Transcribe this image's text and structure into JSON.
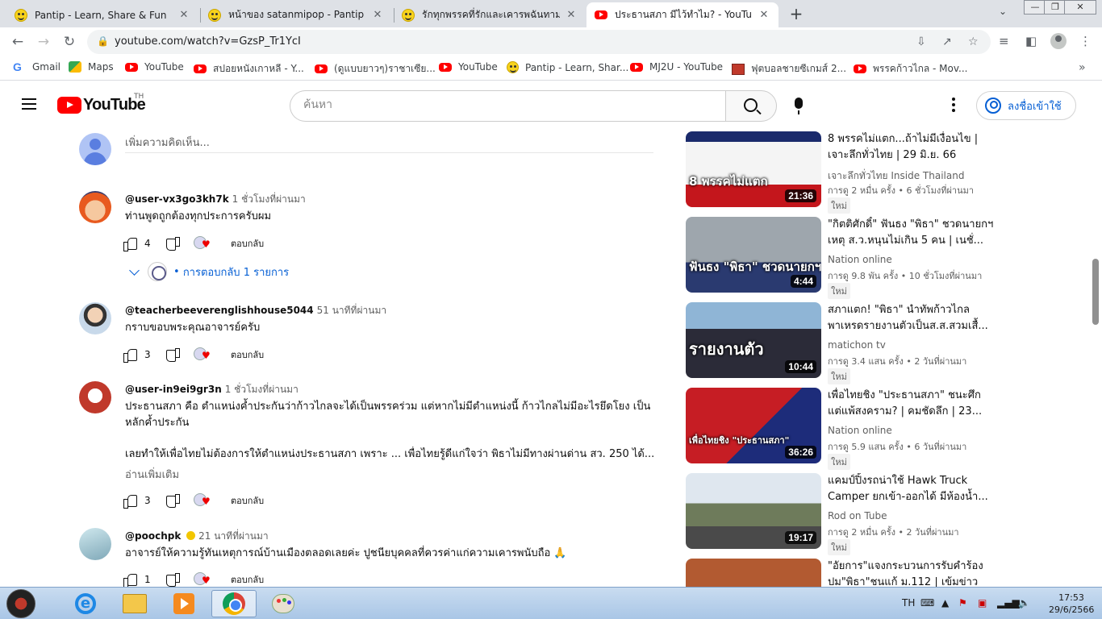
{
  "browser": {
    "tabs": [
      {
        "title": "Pantip - Learn, Share & Fun",
        "icon": "pantip-icon",
        "active": false
      },
      {
        "title": "หน้าของ satanmipop - Pantip",
        "icon": "pantip-icon",
        "active": false
      },
      {
        "title": "รักทุกพรรคที่รักและเคารพฉันทามติ",
        "icon": "pantip-icon",
        "active": false
      },
      {
        "title": "ประธานสภา มีไว้ทำไม? - YouTube",
        "icon": "youtube-icon",
        "active": true
      }
    ],
    "new_tab": "+",
    "tabs_menu": "⌄",
    "window_controls": {
      "minimize": "—",
      "restore": "❐",
      "close": "✕"
    },
    "address": "youtube.com/watch?v=GzsP_Tr1YcI",
    "bookmarks": [
      {
        "label": "Gmail",
        "icon": "google-icon"
      },
      {
        "label": "Maps",
        "icon": "maps-icon"
      },
      {
        "label": "YouTube",
        "icon": "youtube-icon"
      },
      {
        "label": "สปอยหนังเกาหลี - Y...",
        "icon": "youtube-icon"
      },
      {
        "label": "(ดูแบบยาวๆ)ราชาเซีย...",
        "icon": "youtube-icon"
      },
      {
        "label": "YouTube",
        "icon": "youtube-icon"
      },
      {
        "label": "Pantip - Learn, Shar...",
        "icon": "pantip-icon"
      },
      {
        "label": "MJ2U - YouTube",
        "icon": "youtube-icon"
      },
      {
        "label": "ฟุตบอลชายซีเกมส์ 2...",
        "icon": "football-icon"
      },
      {
        "label": "พรรคก้าวไกล - Mov...",
        "icon": "youtube-icon"
      }
    ],
    "bookmarks_more": "»"
  },
  "youtube": {
    "logo_text": "YouTube",
    "country": "TH",
    "search_placeholder": "ค้นหา",
    "signin_label": "ลงชื่อเข้าใช้"
  },
  "comments": {
    "add_placeholder": "เพิ่มความคิดเห็น...",
    "reply_label": "ตอบกลับ",
    "read_more": "อ่านเพิ่มเติม",
    "items": [
      {
        "author": "@user-vx3go3kh7k",
        "time": "1 ชั่วโมงที่ผ่านมา",
        "text": "ท่านพูดถูกต้องทุกประการครับผม",
        "likes": "4",
        "replies": "การตอบกลับ 1 รายการ"
      },
      {
        "author": "@teacherbeeverenglishhouse5044",
        "time": "51 นาทีที่ผ่านมา",
        "text": "กราบขอบพระคุณอาจารย์ครับ",
        "likes": "3"
      },
      {
        "author": "@user-in9ei9gr3n",
        "time": "1 ชั่วโมงที่ผ่านมา",
        "text": "ประธานสภา คือ ตำแหน่งค้ำประกันว่าก้าวไกลจะได้เป็นพรรคร่วม แต่หากไม่มีตำแหน่งนี้ ก้าวไกลไม่มีอะไรยึดโยง เป็นหลักค้ำประกัน",
        "text2": "เลยทำให้เพื่อไทยไม่ต้องการให้ตำแหน่งประธานสภา เพราะ ... เพื่อไทยรู้ดีแก่ใจว่า พิธาไม่มีทางผ่านด่าน สว. 250 ได้...",
        "likes": "3"
      },
      {
        "author": "@poochpk",
        "time": "21 นาทีที่ผ่านมา",
        "text": "อาจารย์ให้ความรู้ทันเหตุการณ์บ้านเมืองตลอดเลยค่ะ ปูชนียบุคคลที่ควรค่าแก่ความเคารพนับถือ 🙏",
        "likes": "1"
      }
    ]
  },
  "recommendations": [
    {
      "title": "8 พรรคไม่แตก...ถ้าไม่มีเงื่อนไข | เจาะลึกทั่วไทย | 29 มิ.ย. 66",
      "channel": "เจาะลึกทั่วไทย Inside Thailand",
      "views": "การดู 2 หมื่น ครั้ง",
      "age": "6 ชั่วโมงที่ผ่านมา",
      "badge": "ใหม่",
      "duration": "21:36",
      "overlay": "8 พรรคไม่แตก"
    },
    {
      "title": "\"กิตติศักดิ์\" ฟันธง \"พิธา\" ชวดนายกฯ เหตุ ส.ว.หนุนไม่เกิน 5 คน | เนชั่...",
      "channel": "Nation online",
      "views": "การดู 9.8 พัน ครั้ง",
      "age": "10 ชั่วโมงที่ผ่านมา",
      "badge": "ใหม่",
      "duration": "4:44",
      "overlay": "ฟันธง \"พิธา\" ชวดนายกฯ"
    },
    {
      "title": "สภาแตก! \"พิธา\" นำทัพก้าวไกล พาเหรดรายงานตัวเป็นส.ส.สวมเสื้...",
      "channel": "matichon tv",
      "views": "การดู 3.4 แสน ครั้ง",
      "age": "2 วันที่ผ่านมา",
      "badge": "ใหม่",
      "duration": "10:44",
      "overlay": "รายงานตัว"
    },
    {
      "title": "เพื่อไทยชิง \"ประธานสภา\" ชนะศึก แต่แพ้สงคราม? | คมชัดลึก | 23...",
      "channel": "Nation online",
      "views": "การดู 5.9 แสน ครั้ง",
      "age": "6 วันที่ผ่านมา",
      "badge": "ใหม่",
      "duration": "36:26",
      "overlay": "เพื่อไทยชิง \"ประธานสภา\""
    },
    {
      "title": "แคมป์ปิ้งรถน่าใช้ Hawk Truck Camper ยกเข้า-ออกได้ มีห้องน้ำ...",
      "channel": "Rod on Tube",
      "views": "การดู 2 หมื่น ครั้ง",
      "age": "2 วันที่ผ่านมา",
      "badge": "ใหม่",
      "duration": "19:17",
      "overlay": ""
    },
    {
      "title": "\"อัยการ\"แจงกระบวนการรับคำร้อง ปม\"พิธา\"ชนแก้ ม.112 | เข้มข่าวเย็น...",
      "channel": "",
      "views": "",
      "age": "",
      "badge": "",
      "duration": "",
      "overlay": ""
    }
  ],
  "taskbar": {
    "lang": "TH",
    "time": "17:53",
    "date": "29/6/2566"
  }
}
